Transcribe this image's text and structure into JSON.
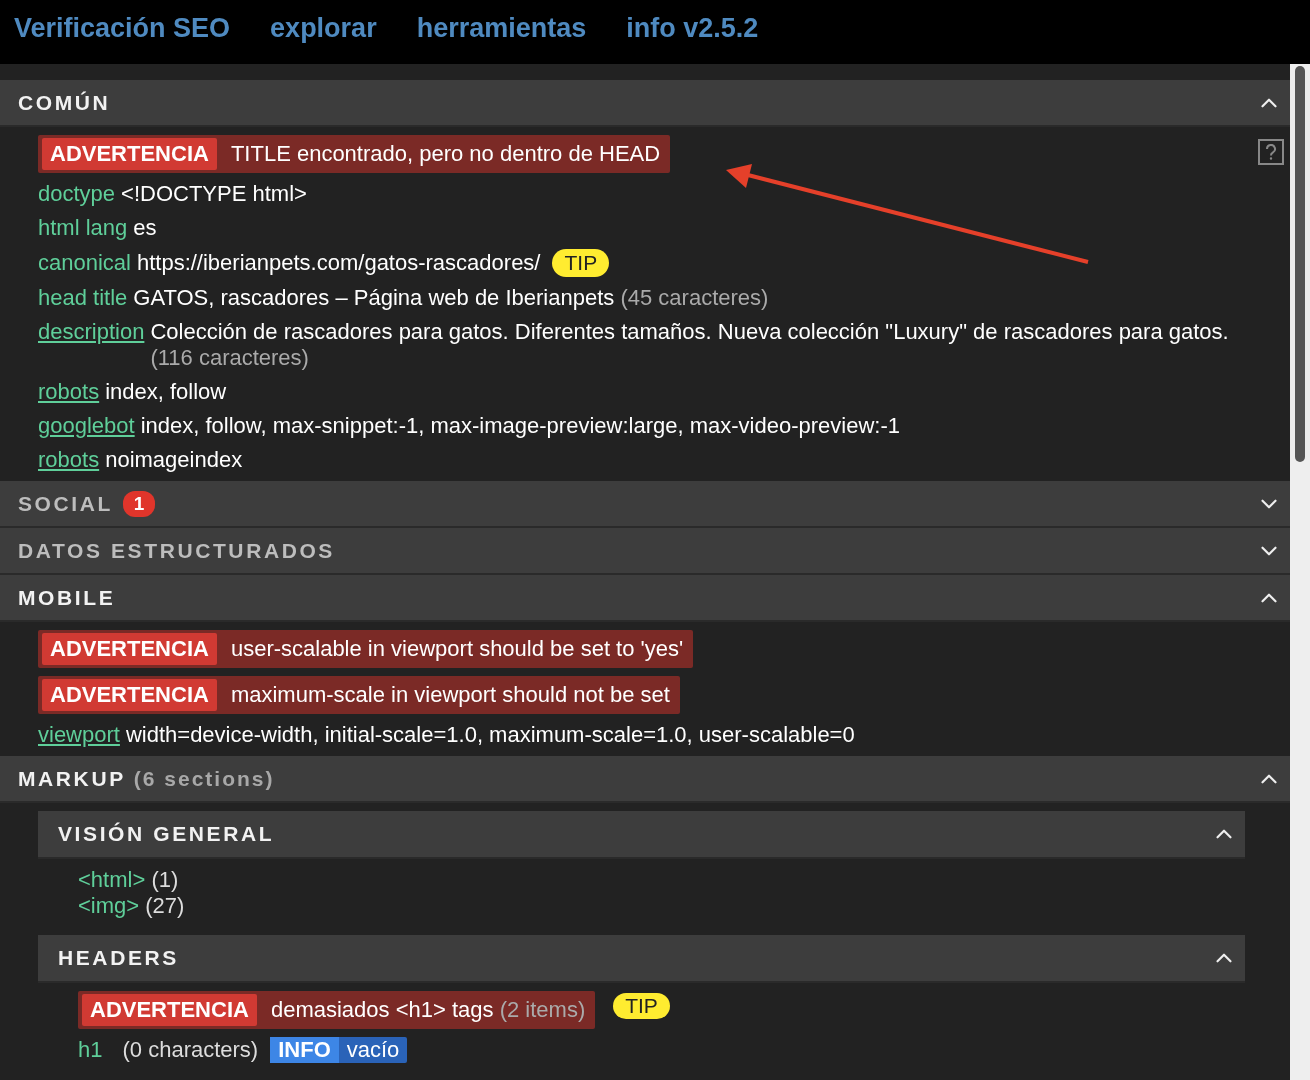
{
  "nav": [
    {
      "label": "Verificación SEO"
    },
    {
      "label": "explorar"
    },
    {
      "label": "herramientas"
    },
    {
      "label": "info v2.5.2"
    }
  ],
  "sections": [
    {
      "title": "COMÚN",
      "expanded": true,
      "help_icon": true,
      "items": [
        {
          "kind": "warning",
          "badge": "ADVERTENCIA",
          "text": "TITLE encontrado, pero no dentro de HEAD"
        },
        {
          "kind": "property",
          "key": "doctype",
          "linked": false,
          "value": "<!DOCTYPE html>"
        },
        {
          "kind": "property",
          "key": "html lang",
          "linked": false,
          "value": "es"
        },
        {
          "kind": "property",
          "key": "canonical",
          "linked": false,
          "value": "https://iberianpets.com/gatos-rascadores/",
          "tip": "TIP"
        },
        {
          "kind": "property",
          "key": "head title",
          "linked": false,
          "value": "GATOS, rascadores – Página web de Iberianpets",
          "note": "(45 caracteres)"
        },
        {
          "kind": "property",
          "key": "description",
          "linked": true,
          "value": "Colección de rascadores para gatos. Diferentes tamaños. Nueva colección \"Luxury\" de rascadores para gatos.",
          "note": "(116 caracteres)"
        },
        {
          "kind": "property",
          "key": "robots",
          "linked": true,
          "value": "index, follow"
        },
        {
          "kind": "property",
          "key": "googlebot",
          "linked": true,
          "value": "index, follow, max-snippet:-1, max-image-preview:large, max-video-preview:-1"
        },
        {
          "kind": "property",
          "key": "robots",
          "linked": true,
          "value": "noimageindex"
        }
      ]
    },
    {
      "title": "SOCIAL",
      "count": "1",
      "expanded": false
    },
    {
      "title": "DATOS ESTRUCTURADOS",
      "expanded": false
    },
    {
      "title": "MOBILE",
      "expanded": true,
      "items": [
        {
          "kind": "warning",
          "badge": "ADVERTENCIA",
          "text": "user-scalable in viewport should be set to 'yes'"
        },
        {
          "kind": "warning",
          "badge": "ADVERTENCIA",
          "text": "maximum-scale in viewport should not be set"
        },
        {
          "kind": "property",
          "key": "viewport",
          "linked": true,
          "value": "width=device-width, initial-scale=1.0, maximum-scale=1.0, user-scalable=0"
        }
      ]
    },
    {
      "title": "MARKUP",
      "subtitle": "(6 sections)",
      "expanded": true,
      "items": [
        {
          "kind": "subsection",
          "title": "VISIÓN GENERAL",
          "expanded": true,
          "items": [
            {
              "kind": "tag",
              "tag": "<html>",
              "count": "(1)"
            },
            {
              "kind": "tag",
              "tag": "<img>",
              "count": "(27)"
            }
          ]
        },
        {
          "kind": "subsection",
          "title": "HEADERS",
          "expanded": true,
          "items": [
            {
              "kind": "warning",
              "badge": "ADVERTENCIA",
              "text": "demasiados <h1> tags",
              "note": "(2 items)",
              "tip": "TIP"
            },
            {
              "kind": "heading",
              "key": "h1",
              "note": "(0 characters)",
              "badge": "INFO",
              "value": "vacío"
            }
          ]
        }
      ]
    }
  ]
}
